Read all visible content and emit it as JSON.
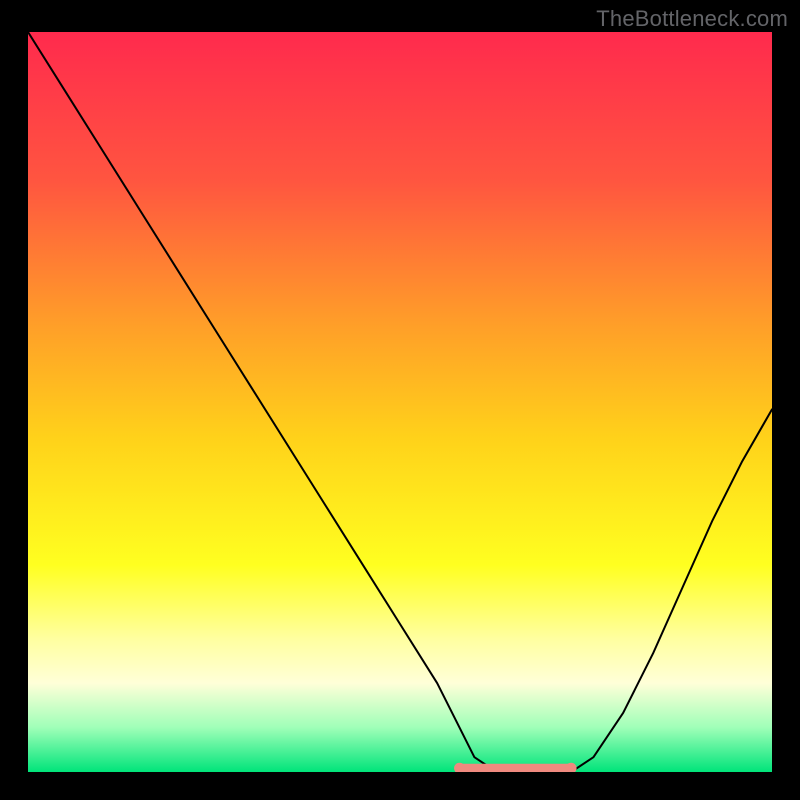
{
  "watermark": "TheBottleneck.com",
  "chart_data": {
    "type": "line",
    "title": "",
    "xlabel": "",
    "ylabel": "",
    "xlim": [
      0,
      100
    ],
    "ylim": [
      0,
      100
    ],
    "gradient_stops": [
      {
        "offset": 0.0,
        "color": "#ff2a4d"
      },
      {
        "offset": 0.2,
        "color": "#ff5540"
      },
      {
        "offset": 0.4,
        "color": "#ffa028"
      },
      {
        "offset": 0.55,
        "color": "#ffd21a"
      },
      {
        "offset": 0.72,
        "color": "#ffff20"
      },
      {
        "offset": 0.82,
        "color": "#ffffa0"
      },
      {
        "offset": 0.88,
        "color": "#ffffd8"
      },
      {
        "offset": 0.94,
        "color": "#9fffb8"
      },
      {
        "offset": 1.0,
        "color": "#00e47a"
      }
    ],
    "series": [
      {
        "name": "bottleneck-curve",
        "color": "#000000",
        "width": 2,
        "x": [
          0,
          5,
          10,
          15,
          20,
          25,
          30,
          35,
          40,
          45,
          50,
          55,
          58,
          60,
          63,
          66,
          70,
          73,
          76,
          80,
          84,
          88,
          92,
          96,
          100
        ],
        "y": [
          100,
          92,
          84,
          76,
          68,
          60,
          52,
          44,
          36,
          28,
          20,
          12,
          6,
          2,
          0,
          0,
          0,
          0,
          2,
          8,
          16,
          25,
          34,
          42,
          49
        ]
      }
    ],
    "marker": {
      "name": "optimal-range-marker",
      "color": "#ef8a7f",
      "x": [
        58,
        73
      ],
      "y": [
        0.5,
        0.5
      ],
      "cap_radius": 5.5,
      "thickness": 9
    }
  }
}
